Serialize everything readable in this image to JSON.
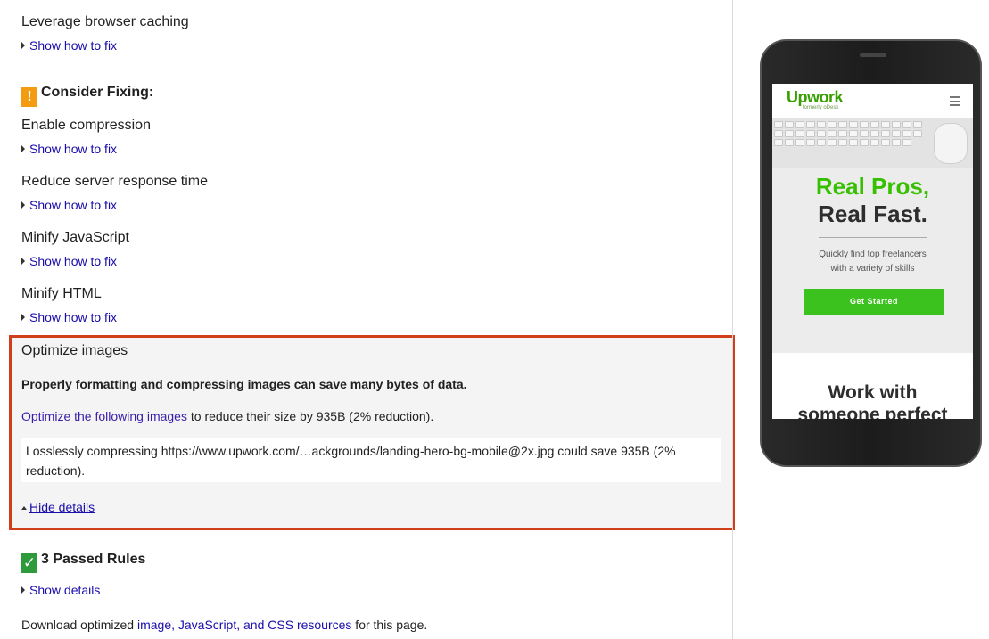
{
  "rules": {
    "leverage": {
      "title": "Leverage browser caching",
      "fix": "Show how to fix"
    },
    "consider_heading": "Consider Fixing:",
    "warn_badge": "!",
    "compression": {
      "title": "Enable compression",
      "fix": "Show how to fix"
    },
    "server": {
      "title": "Reduce server response time",
      "fix": "Show how to fix"
    },
    "minjs": {
      "title": "Minify JavaScript",
      "fix": "Show how to fix"
    },
    "minhtml": {
      "title": "Minify HTML",
      "fix": "Show how to fix"
    }
  },
  "optimize": {
    "title": "Optimize images",
    "summary": "Properly formatting and compressing images can save many bytes of data.",
    "link": "Optimize the following images",
    "line_rest": " to reduce their size by 935B (2% reduction).",
    "detail": "Losslessly compressing https://www.upwork.com/…ackgrounds/landing-hero-bg-mobile@2x.jpg could save 935B (2% reduction).",
    "hide": "Hide details"
  },
  "passed": {
    "badge": "✓",
    "heading": "3 Passed Rules",
    "show": "Show details"
  },
  "download": {
    "prefix": "Download optimized ",
    "link": "image, JavaScript, and CSS resources",
    "suffix": " for this page."
  },
  "phone": {
    "logo": "Upwork",
    "logo_sub": "formerly oDesk",
    "hero_line1": "Real Pros,",
    "hero_line2": "Real Fast.",
    "sub_line1": "Quickly find top freelancers",
    "sub_line2": "with a variety of skills",
    "cta": "Get Started",
    "work_line1": "Work with",
    "work_line2": "someone perfect"
  },
  "colors": {
    "link": "#1a0dab",
    "highlight_border": "#d13f1a",
    "warn_badge": "#f39c12",
    "pass_badge": "#2e9a3c",
    "upwork_green": "#37c000"
  }
}
